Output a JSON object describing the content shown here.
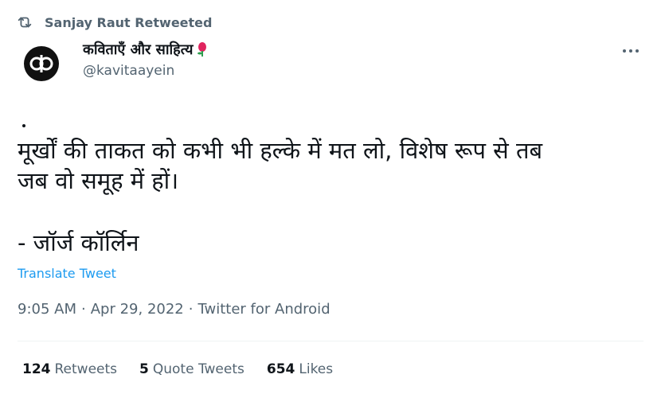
{
  "retweet": {
    "icon": "retweet-icon",
    "text": "Sanjay Raut Retweeted"
  },
  "author": {
    "name": "कविताएँ और साहित्य",
    "handle": "@kavitaayein",
    "avatar_text": "cp",
    "name_emoji_icon": "rose-icon"
  },
  "tweet": {
    "text": "मूर्खों की ताकत को कभी भी हल्के में मत लो, विशेष रूप से तब\nजब वो समूह में हों।",
    "attribution": "- जॉर्ज कॉर्लिन",
    "translate_label": "Translate Tweet",
    "time": "9:05 AM",
    "date": "Apr 29, 2022",
    "source": "Twitter for Android",
    "separator": "·"
  },
  "stats": {
    "retweets_count": "124",
    "retweets_label": "Retweets",
    "quotes_count": "5",
    "quotes_label": "Quote Tweets",
    "likes_count": "654",
    "likes_label": "Likes"
  },
  "colors": {
    "link": "#1d9bf0",
    "muted": "#536471",
    "text": "#0f1419"
  }
}
